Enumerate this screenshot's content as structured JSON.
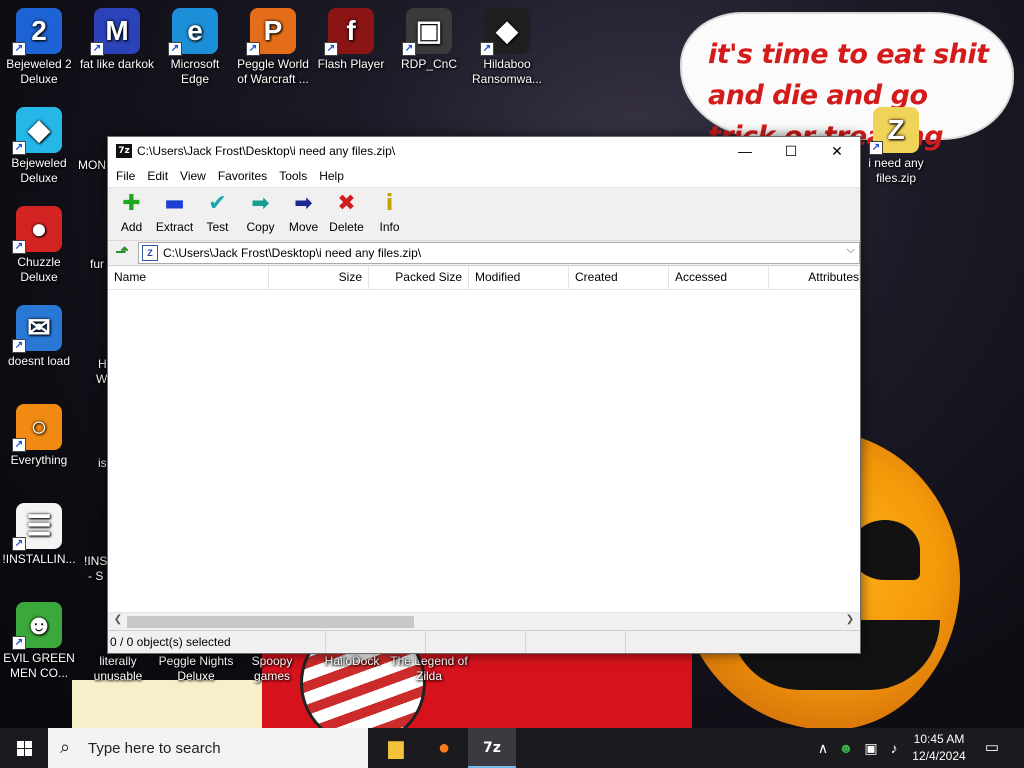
{
  "wallpaper": {
    "bubble_text": "it's time to eat shit and die and go trick or treating and die!"
  },
  "desktop_icons": [
    {
      "label": "Bejeweled 2 Deluxe",
      "glyph": "2",
      "color": "#1e63d6"
    },
    {
      "label": "fat like darkok",
      "glyph": "M",
      "color": "#2b42b8"
    },
    {
      "label": "Microsoft Edge",
      "glyph": "e",
      "color": "#1d8fd8"
    },
    {
      "label": "Peggle World of Warcraft ...",
      "glyph": "P",
      "color": "#e46d1a"
    },
    {
      "label": "Flash Player",
      "glyph": "f",
      "color": "#8b1414"
    },
    {
      "label": "RDP_CnC",
      "glyph": "▣",
      "color": "#3b3b3b"
    },
    {
      "label": "Hildaboo Ransomwa...",
      "glyph": "◆",
      "color": "#1f1f1f"
    },
    {
      "label": "Bejeweled Deluxe",
      "glyph": "◆",
      "color": "#25b7e8"
    },
    {
      "label": "Chuzzle Deluxe",
      "glyph": "●",
      "color": "#d42323"
    },
    {
      "label": "doesnt load",
      "glyph": "✉",
      "color": "#2a78d6"
    },
    {
      "label": "Everything",
      "glyph": "○",
      "color": "#f08a13"
    },
    {
      "label": "!INSTALLIN...",
      "glyph": "☰",
      "color": "#f4f4f4"
    },
    {
      "label": "EVIL GREEN MEN CO...",
      "glyph": "☻",
      "color": "#3aa83a"
    },
    {
      "label": "i need any files.zip",
      "glyph": "Z",
      "color": "#f0d45a"
    }
  ],
  "partial_labels": {
    "col2_mon": "MON",
    "col2_fur": "fur",
    "col2_h": "H",
    "col2_w": "W",
    "col2_is": "is",
    "col2_inst": "!INST",
    "col2_s": "- S",
    "literally": "literally unusable",
    "peggle_nights": "Peggle Nights Deluxe",
    "spoopy": "Spoopy games",
    "hallodock": "HalloDock",
    "zilda": "The Legend of Zilda"
  },
  "window": {
    "title": "C:\\Users\\Jack Frost\\Desktop\\i need any  files.zip\\",
    "app_icon": "7z",
    "controls": {
      "minimize": "—",
      "maximize": "☐",
      "close": "✕"
    },
    "menu": [
      "File",
      "Edit",
      "View",
      "Favorites",
      "Tools",
      "Help"
    ],
    "toolbar": [
      {
        "label": "Add",
        "glyph": "✚",
        "color": "#1ea81e"
      },
      {
        "label": "Extract",
        "glyph": "▬",
        "color": "#1b3fd1"
      },
      {
        "label": "Test",
        "glyph": "✔",
        "color": "#17a7b3"
      },
      {
        "label": "Copy",
        "glyph": "➡",
        "color": "#16a08f"
      },
      {
        "label": "Move",
        "glyph": "➡",
        "color": "#1b2a8f"
      },
      {
        "label": "Delete",
        "glyph": "✖",
        "color": "#d11c1c"
      },
      {
        "label": "Info",
        "glyph": "i",
        "color": "#c8a000"
      }
    ],
    "address": "C:\\Users\\Jack Frost\\Desktop\\i need any  files.zip\\",
    "columns": [
      "Name",
      "Size",
      "Packed Size",
      "Modified",
      "Created",
      "Accessed",
      "Attributes"
    ],
    "status": "0 / 0 object(s) selected"
  },
  "taskbar": {
    "search_placeholder": "Type here to search",
    "apps": [
      {
        "name": "file-explorer-icon",
        "glyph": "▆",
        "color": "#f2c23a"
      },
      {
        "name": "firefox-icon",
        "glyph": "●",
        "color": "#ff7a1a"
      },
      {
        "name": "7zip-icon",
        "glyph": "7z",
        "color": "#ffffff"
      }
    ],
    "time": "10:45 AM",
    "date": "12/4/2024"
  }
}
